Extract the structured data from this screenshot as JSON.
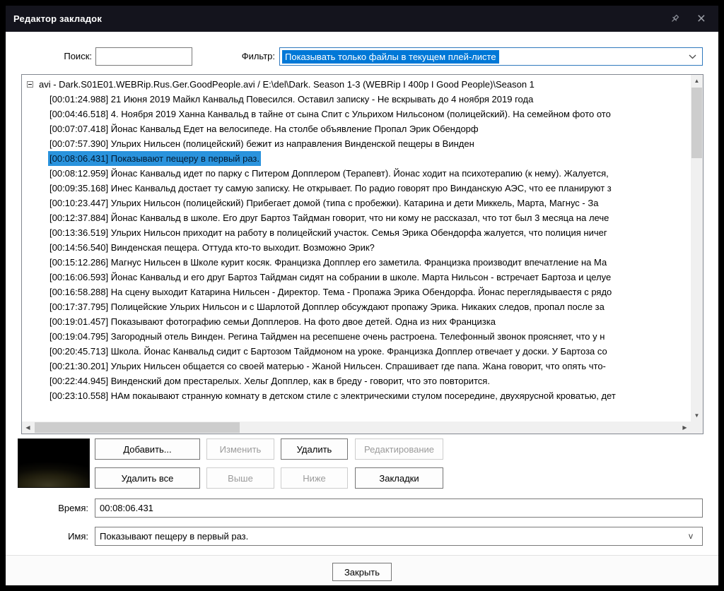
{
  "window": {
    "title": "Редактор закладок",
    "icons": {
      "close": "×"
    }
  },
  "toolbar": {
    "search_label": "Поиск:",
    "search_value": "",
    "filter_label": "Фильтр:",
    "filter_value": "Показывать только файлы в текущем плей-листе"
  },
  "tree": {
    "root_label": "avi - Dark.S01E01.WEBRip.Rus.Ger.GoodPeople.avi / E:\\del\\Dark. Season 1-3 (WEBRip I 400p I Good People)\\Season 1",
    "selected_index": 4,
    "items": [
      "[00:01:24.988] 21 Июня 2019 Майкл Канвальд Повесился. Оставил записку - Не вскрывать до 4 ноября 2019 года",
      "[00:04:46.518] 4. Ноября 2019 Ханна Канвальд в тайне от сына Спит с Ульрихом Нильсоном (полицейский). На семейном фото ото",
      "[00:07:07.418] Йонас Канвальд Едет на велосипеде. На столбе объявление Пропал Эрик Обендорф",
      "[00:07:57.390] Ульрих Нильсен (полицейский) бежит из направления Винденской пещеры в Винден",
      "[00:08:06.431] Показывают пещеру в первый раз.",
      "[00:08:12.959] Йонас Канвальд идет по парку с Питером Допплером (Терапевт). Йонас ходит на психотерапию (к нему). Жалуется,",
      "[00:09:35.168] Инес Канвальд достает ту самую записку. Не открывает. По радио говорят про Винданскую АЭС, что ее планируют з",
      "[00:10:23.447] Ульрих Нильсон (полицейский) Прибегает домой (типа с пробежки).  Катарина и дети Миккель, Марта, Магнус - За",
      "[00:12:37.884] Йонас Канвальд в школе. Его друг Бартоз Тайдман говорит, что ни кому не рассказал, что тот был 3 месяца на лече",
      "[00:13:36.519] Ульрих Нильсон приходит на работу в полицейский участок. Семья Эрика Обендорфа жалуется, что полиция ничег",
      "[00:14:56.540] Винденская пещера. Оттуда кто-то выходит. Возможно Эрик?",
      "[00:15:12.286] Магнус Нильсен в Школе курит косяк. Францизка Допплер его заметила. Францизка производит впечатление на Ма",
      "[00:16:06.593] Йонас Канвальд и его друг Бартоз Тайдман сидят на собрании в школе. Марта Нильсон - встречает Бартоза и целуе",
      "[00:16:58.288] На сцену выходит Катарина Нильсен - Директор. Тема - Пропажа Эрика Обендорфа. Йонас переглядываестя с рядо",
      "[00:17:37.795] Полицейские Ульрих Нильсон и с Шарлотой Допплер обсуждают пропажу Эрика. Никаких следов, пропал после за",
      "[00:19:01.457] Показывают фотографию семьи Допплеров. На фото двое детей. Одна из них Францизка",
      "[00:19:04.795] Загородный отель Винден. Регина Тайдмен на ресепшене очень растроена. Телефонный звонок проясняет, что у н",
      "[00:20:45.713] Школа. Йонас Канвальд сидит с Бартозом Тайдмоном на уроке. Францизка Допплер отвечает у доски. У Бартоза со",
      "[00:21:30.201] Ульрих Нильсен общается со своей матерью - Жаной Нильсен. Спрашивает где папа. Жана говорит, что опять что-",
      "[00:22:44.945] Винденский дом престарелых. Хельг Допплер, как в бреду - говорит, что это повторится.",
      "[00:23:10.558] НАм покаывают странную комнату в детском стиле с электрическими стулом посередине, двухярусной кроватью, дет"
    ]
  },
  "buttons": {
    "add": "Добавить...",
    "edit": "Изменить",
    "delete": "Удалить",
    "editing": "Редактирование",
    "delete_all": "Удалить все",
    "up": "Выше",
    "down": "Ниже",
    "bookmarks": "Закладки",
    "close": "Закрыть"
  },
  "fields": {
    "time_label": "Время:",
    "time_value": "00:08:06.431",
    "name_label": "Имя:",
    "name_value": "Показывают пещеру в первый раз.",
    "name_dropdown_glyph": "v"
  },
  "scrollbar_icons": {
    "up": "▲",
    "down": "▼",
    "left": "◀",
    "right": "▶"
  },
  "colors": {
    "titlebar_bg": "#14141d",
    "accent": "#0078d7",
    "list_selection_bg": "#2a93dd",
    "list_selection_text": "#00182e"
  }
}
